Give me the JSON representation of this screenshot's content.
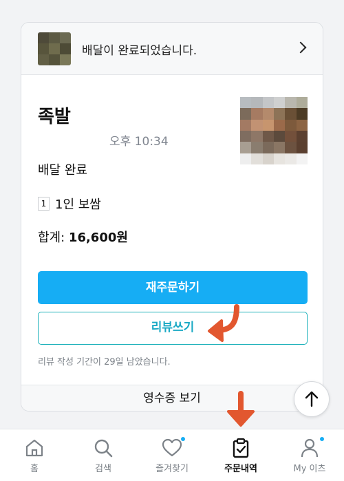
{
  "banner": {
    "message": "배달이 완료되었습니다.",
    "thumb_icon": "food-thumbnail",
    "chevron_icon": "chevron-right-icon"
  },
  "order": {
    "store_name": "족발",
    "time": "오후 10:34",
    "status": "배달 완료",
    "item_qty": "1",
    "item_name": "1인 보쌈",
    "total_label": "합계:",
    "total_amount": "16,600원"
  },
  "actions": {
    "reorder_label": "재주문하기",
    "review_label": "리뷰쓰기",
    "review_note": "리뷰 작성 기간이 29일 남았습니다.",
    "receipt_label": "영수증 보기"
  },
  "bottom_nav": {
    "items": [
      {
        "label": "홈",
        "icon": "home-icon"
      },
      {
        "label": "검색",
        "icon": "search-icon"
      },
      {
        "label": "즐겨찾기",
        "icon": "heart-icon"
      },
      {
        "label": "주문내역",
        "icon": "clipboard-check-icon"
      },
      {
        "label": "My 이츠",
        "icon": "person-icon"
      }
    ]
  },
  "colors": {
    "primary": "#16adf4",
    "review_border": "#19b0b9",
    "annotation_arrow": "#e2572f",
    "notification_dot": "#16adf4"
  }
}
